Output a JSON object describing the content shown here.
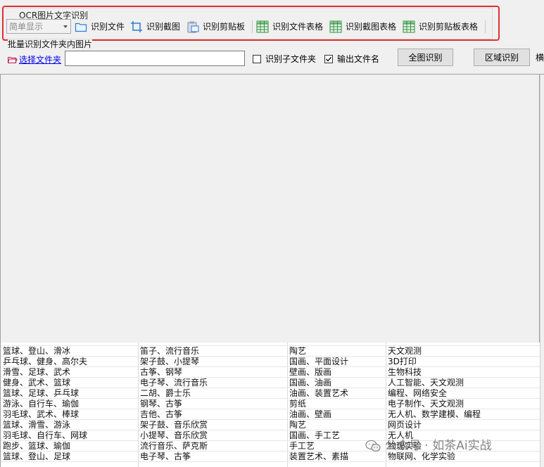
{
  "ocr": {
    "group_title": "OCR图片文字识别",
    "mode_select": "简单显示",
    "toolbar": [
      {
        "label": "识别文件",
        "icon": "folder-icon"
      },
      {
        "label": "识别截图",
        "icon": "crop-icon"
      },
      {
        "label": "识别剪贴板",
        "icon": "clipboard-icon"
      },
      {
        "label": "识别文件表格",
        "icon": "table-icon"
      },
      {
        "label": "识别截图表格",
        "icon": "table-icon"
      },
      {
        "label": "识别剪贴板表格",
        "icon": "table-icon"
      }
    ]
  },
  "batch": {
    "title": "批量识别文件夹内图片",
    "select_folder": "选择文件夹",
    "folder_path": "",
    "subfolder_label": "识别子文件夹",
    "subfolder_checked": false,
    "output_filename_label": "输出文件名",
    "output_filename_checked": true,
    "full_button": "全图识别",
    "region_button": "区域识别",
    "cut_text": "横"
  },
  "results": {
    "rows": [
      [
        "篮球、登山、滑冰",
        "笛子、流行音乐",
        "陶艺",
        "天文观测"
      ],
      [
        "乒乓球、健身、高尔夫",
        "架子鼓、小提琴",
        "国画、平面设计",
        "3D打印"
      ],
      [
        "滑雪、足球、武术",
        "古筝、钢琴",
        "壁画、版画",
        "生物科技"
      ],
      [
        "健身、武术、篮球",
        "电子琴、流行音乐",
        "国画、油画",
        "人工智能、天文观测"
      ],
      [
        "篮球、足球、乒乓球",
        "二胡、爵士乐",
        "油画、装置艺术",
        "编程、网络安全"
      ],
      [
        "游泳、自行车、瑜伽",
        "钢琴、古筝",
        "剪纸",
        "电子制作、天文观测"
      ],
      [
        "羽毛球、武术、棒球",
        "吉他、古筝",
        "油画、壁画",
        "无人机、数学建模、编程"
      ],
      [
        "篮球、滑雪、游泳",
        "架子鼓、音乐欣赏",
        "陶艺",
        "网页设计"
      ],
      [
        "羽毛球、自行车、网球",
        "小提琴、音乐欣赏",
        "国画、手工艺",
        "无人机"
      ],
      [
        "跑步、篮球、瑜伽",
        "流行音乐、萨克斯",
        "手工艺",
        "物理实验"
      ],
      [
        "篮球、登山、足球",
        "电子琴、古筝",
        "装置艺术、素描",
        "物联网、化学实验"
      ]
    ]
  },
  "watermark": {
    "text": "公众号 · 如茶Ai实战",
    "icon": "wechat-icon"
  }
}
